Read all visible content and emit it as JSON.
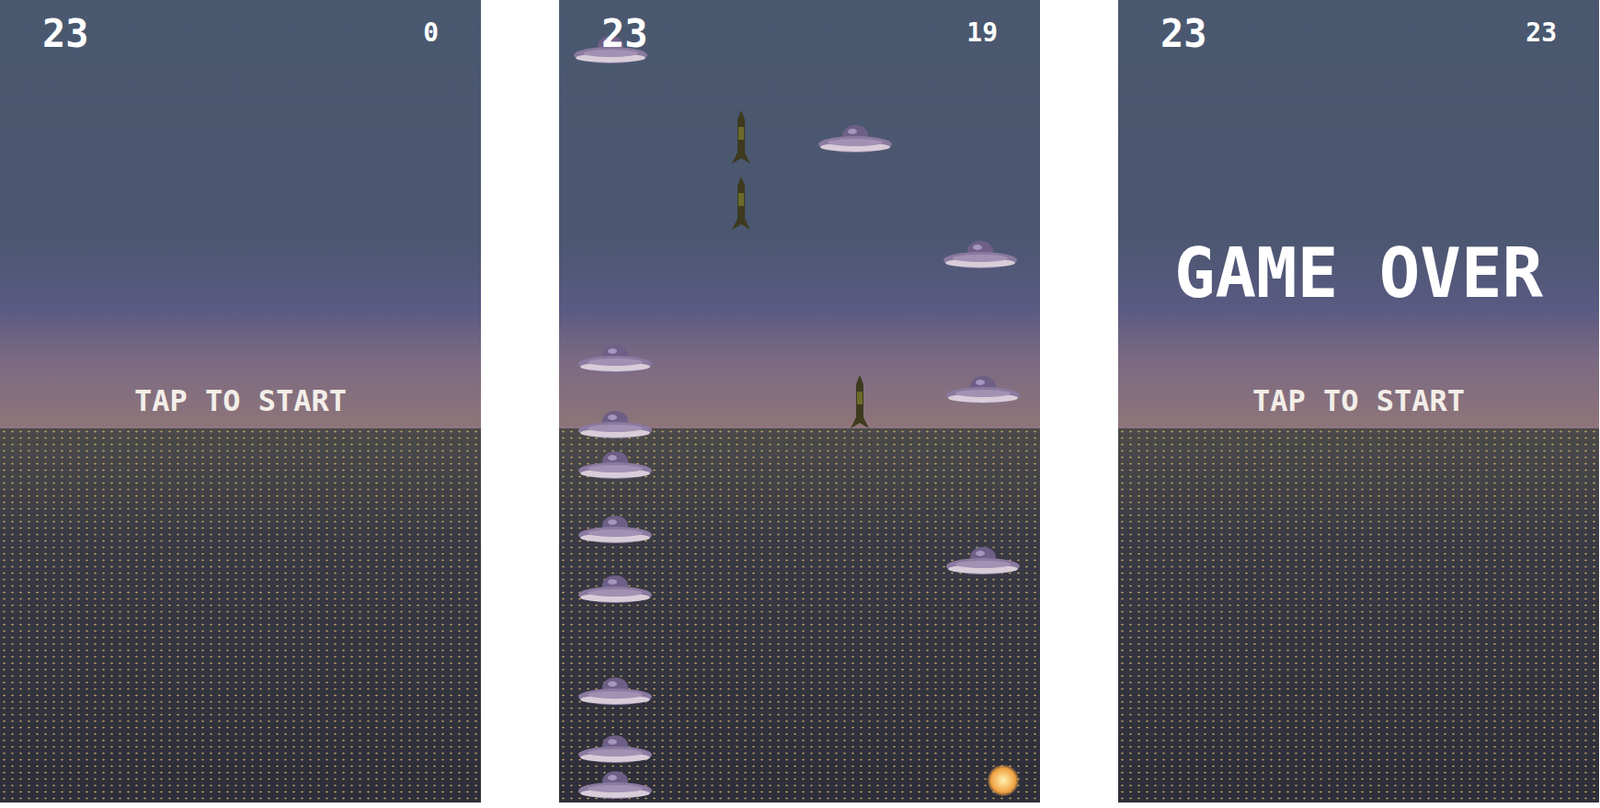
{
  "screens": [
    {
      "kind": "start",
      "best": "23",
      "score": "0",
      "title": "",
      "prompt": "TAP TO START"
    },
    {
      "kind": "playing",
      "best": "23",
      "score": "19",
      "title": "",
      "prompt": ""
    },
    {
      "kind": "over",
      "best": "23",
      "score": "23",
      "title": "GAME OVER",
      "prompt": "TAP TO START"
    }
  ]
}
